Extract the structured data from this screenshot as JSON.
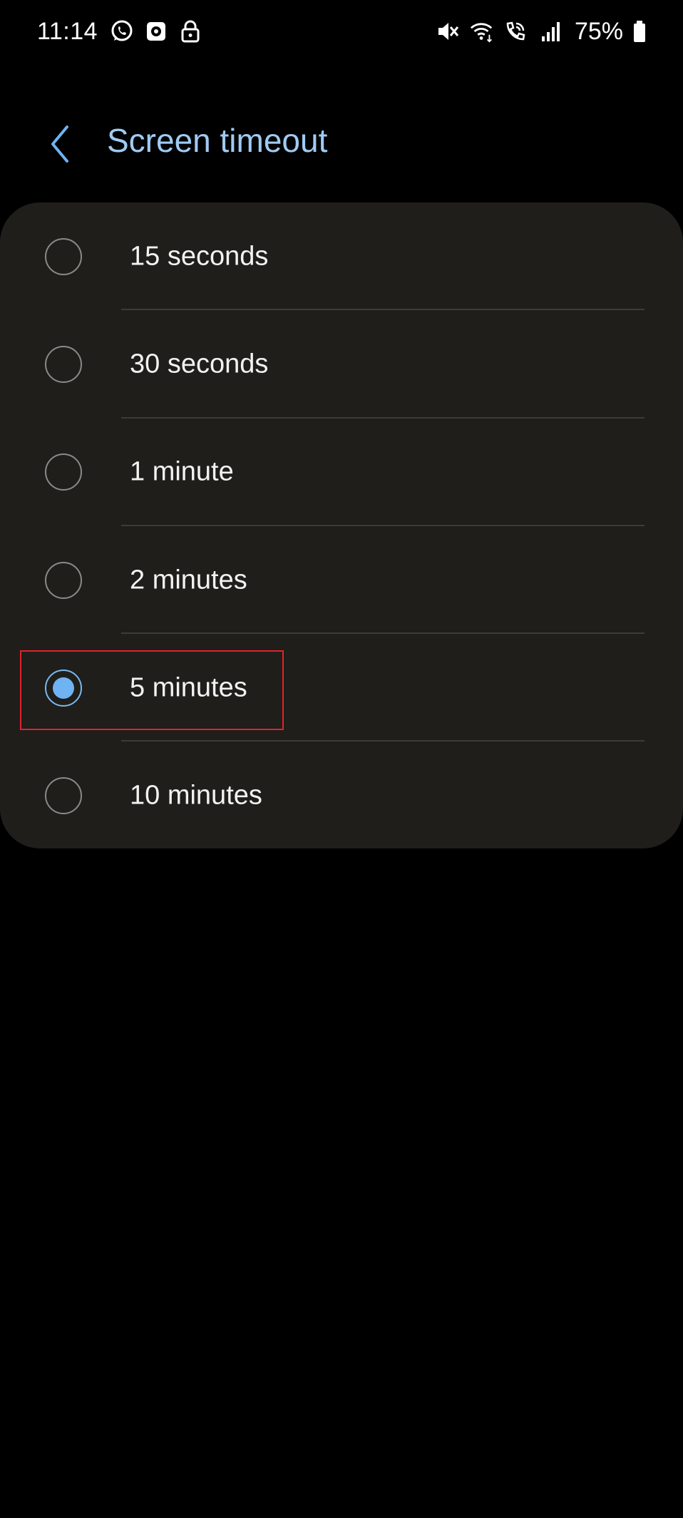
{
  "status_bar": {
    "time": "11:14",
    "battery": "75%",
    "left_icons": [
      "whatsapp-icon",
      "camera-app-icon",
      "lock-icon"
    ],
    "right_icons": [
      "mute-icon",
      "wifi-icon",
      "wifi-call-icon",
      "signal-icon",
      "battery-icon"
    ]
  },
  "header": {
    "title": "Screen timeout",
    "back_icon": "chevron-left-icon"
  },
  "options": [
    {
      "label": "15 seconds",
      "selected": false
    },
    {
      "label": "30 seconds",
      "selected": false
    },
    {
      "label": "1 minute",
      "selected": false
    },
    {
      "label": "2 minutes",
      "selected": false
    },
    {
      "label": "5 minutes",
      "selected": true
    },
    {
      "label": "10 minutes",
      "selected": false
    }
  ],
  "colors": {
    "background": "#000000",
    "card": "#1f1e1b",
    "title": "#9fcbf3",
    "accent": "#6fb3f2",
    "highlight": "#e0232b"
  }
}
